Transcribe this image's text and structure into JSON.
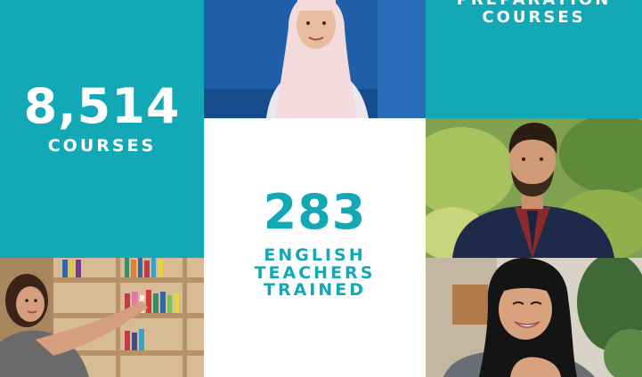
{
  "stats": {
    "courses": {
      "number": "8,514",
      "label": "COURSES"
    },
    "preparation": {
      "line1": "PREPARATION",
      "line2": "COURSES"
    },
    "teachers": {
      "number": "283",
      "line1": "ENGLISH",
      "line2": "TEACHERS",
      "line3": "TRAINED"
    }
  },
  "colors": {
    "teal": "#12a8b6",
    "white": "#ffffff"
  },
  "photos": [
    {
      "name": "student-photo-top-center"
    },
    {
      "name": "teacher-photo-right-man"
    },
    {
      "name": "teacher-photo-bottom-left-woman-bookshelf"
    },
    {
      "name": "teacher-photo-bottom-right-woman-hijab"
    }
  ]
}
